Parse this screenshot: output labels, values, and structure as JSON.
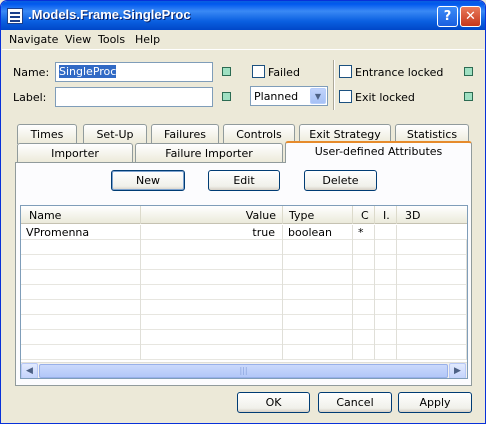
{
  "window": {
    "title": ".Models.Frame.SingleProc"
  },
  "menu": [
    "Navigate",
    "View",
    "Tools",
    "Help"
  ],
  "form": {
    "name_label": "Name:",
    "name_value": "SingleProc",
    "label_label": "Label:",
    "label_value": "",
    "failed_label": "Failed",
    "status_value": "Planned",
    "entrance_locked_label": "Entrance locked",
    "exit_locked_label": "Exit locked"
  },
  "tabs_row1": [
    "Times",
    "Set-Up",
    "Failures",
    "Controls",
    "Exit Strategy",
    "Statistics"
  ],
  "tabs_row2": [
    "Importer",
    "Failure Importer",
    "User-defined Attributes"
  ],
  "active_tab": "User-defined Attributes",
  "panel_buttons": {
    "new": "New",
    "edit": "Edit",
    "delete": "Delete"
  },
  "table": {
    "headers": [
      "Name",
      "Value",
      "Type",
      "C",
      "I.",
      "3D"
    ],
    "rows": [
      {
        "name": "VPromenna",
        "value": "true",
        "type": "boolean",
        "c": "*",
        "i": "",
        "d3": ""
      }
    ]
  },
  "footer": {
    "ok": "OK",
    "cancel": "Cancel",
    "apply": "Apply"
  },
  "colors": {
    "title_bar": "#0a5fe0",
    "active_tab_accent": "#e68b2c",
    "indicator": "#9fe0c2"
  }
}
